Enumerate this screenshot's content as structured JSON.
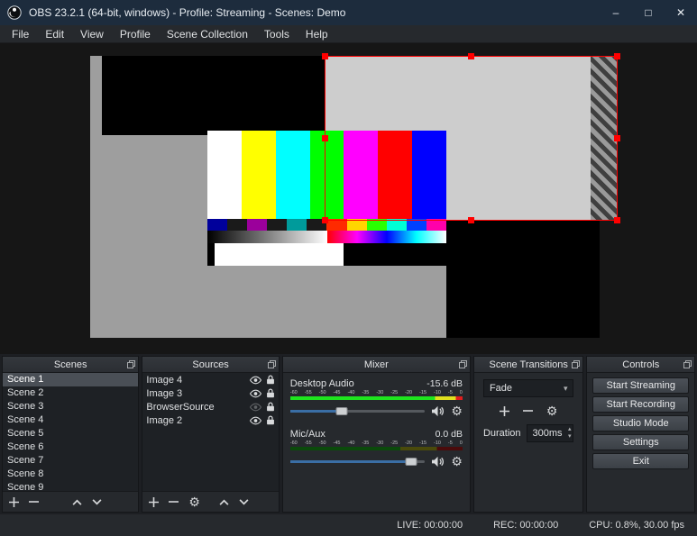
{
  "titlebar": {
    "title": "OBS 23.2.1 (64-bit, windows) - Profile: Streaming - Scenes: Demo",
    "minimize": "–",
    "maximize": "□",
    "close": "✕"
  },
  "menubar": {
    "items": [
      "File",
      "Edit",
      "View",
      "Profile",
      "Scene Collection",
      "Tools",
      "Help"
    ]
  },
  "panels": {
    "scenes": {
      "title": "Scenes",
      "items": [
        "Scene 1",
        "Scene 2",
        "Scene 3",
        "Scene 4",
        "Scene 5",
        "Scene 6",
        "Scene 7",
        "Scene 8",
        "Scene 9"
      ],
      "selected": "Scene 1"
    },
    "sources": {
      "title": "Sources",
      "items": [
        {
          "name": "Image 4",
          "visible": true,
          "locked": true
        },
        {
          "name": "Image 3",
          "visible": true,
          "locked": true
        },
        {
          "name": "BrowserSource",
          "visible": false,
          "locked": true
        },
        {
          "name": "Image 2",
          "visible": true,
          "locked": true
        }
      ]
    },
    "mixer": {
      "title": "Mixer",
      "scale": [
        "-60",
        "-55",
        "-50",
        "-45",
        "-40",
        "-35",
        "-30",
        "-25",
        "-20",
        "-15",
        "-10",
        "-5",
        "0"
      ],
      "channels": [
        {
          "name": "Desktop Audio",
          "level": "-15.6 dB",
          "meter_pct": 100,
          "fader_pct": 38
        },
        {
          "name": "Mic/Aux",
          "level": "0.0 dB",
          "meter_pct": 0,
          "fader_pct": 90
        }
      ]
    },
    "transitions": {
      "title": "Scene Transitions",
      "selected": "Fade",
      "duration_label": "Duration",
      "duration_value": "300ms"
    },
    "controls": {
      "title": "Controls",
      "buttons": [
        "Start Streaming",
        "Start Recording",
        "Studio Mode",
        "Settings",
        "Exit"
      ]
    }
  },
  "statusbar": {
    "live": "LIVE: 00:00:00",
    "rec": "REC: 00:00:00",
    "cpu": "CPU: 0.8%, 30.00 fps"
  },
  "preview": {
    "colorbars": [
      "#ffffff",
      "#ffff00",
      "#00ffff",
      "#00ff00",
      "#ff00ff",
      "#ff0000",
      "#0000ff"
    ],
    "rowA": [
      "#00009b",
      "#1a1a1a",
      "#9b009b",
      "#1a1a1a",
      "#009b9b",
      "#1a1a1a",
      "#ff2a00",
      "#ffd500",
      "#2aff00",
      "#00ffd5",
      "#0040ff",
      "#ff00aa"
    ],
    "colors": {
      "canvas": "#9e9e9e",
      "selected_source": "#cdcdcd",
      "selection": "#ff0000"
    }
  }
}
